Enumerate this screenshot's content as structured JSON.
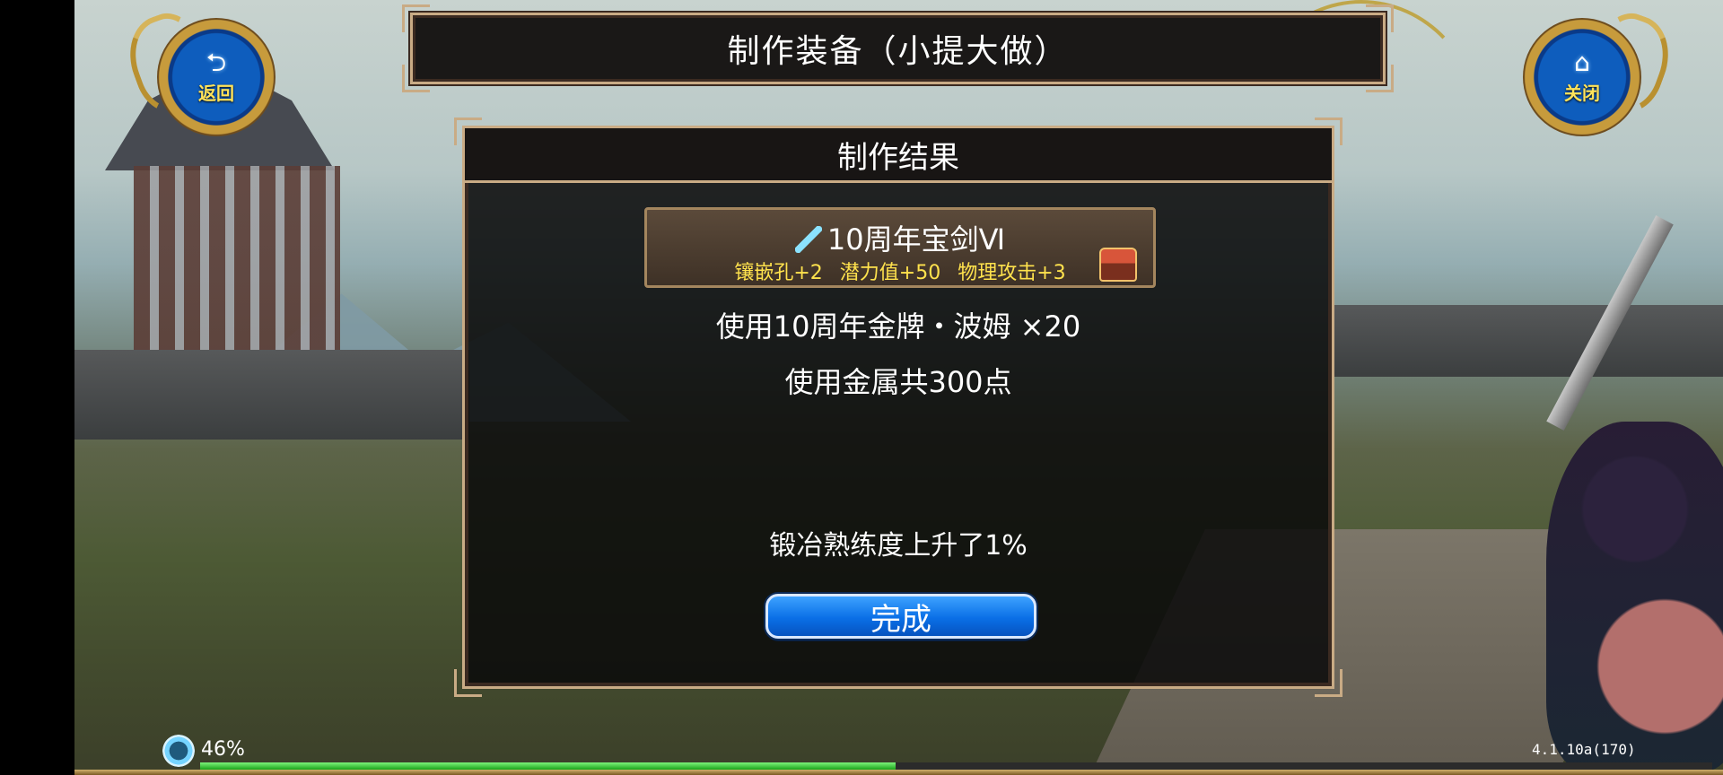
{
  "buttons": {
    "back": {
      "icon": "back-arrow-icon",
      "glyph": "⮌",
      "label": "返回"
    },
    "close": {
      "icon": "home-icon",
      "glyph": "⌂",
      "label": "关闭"
    }
  },
  "title": "制作装备（小提大做）",
  "panel": {
    "header": "制作结果",
    "item": {
      "name": "10周年宝剑Ⅵ",
      "stats": [
        "镶嵌孔+2",
        "潜力值+50",
        "物理攻击+3"
      ]
    },
    "material_line": "使用10周年金牌・波姆 ×20",
    "metal_line": "使用金属共300点",
    "proficiency_line": "锻冶熟练度上升了1%",
    "done_label": "完成"
  },
  "status": {
    "progress_text": "46%",
    "progress_value": 0.46,
    "version": "4.1.10a(170)"
  },
  "colors": {
    "frame_border": "#c9ab85",
    "stat_yellow": "#ffe24d",
    "button_blue": "#0a6fe6",
    "xp_green": "#1aa41a"
  }
}
